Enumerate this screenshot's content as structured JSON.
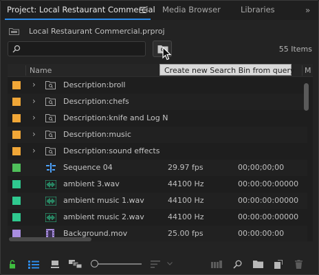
{
  "tabs": [
    {
      "label": "Project: Local Restaurant Commercial",
      "active": true
    },
    {
      "label": "Media Browser",
      "active": false
    },
    {
      "label": "Libraries",
      "active": false
    }
  ],
  "project": {
    "file_name": "Local Restaurant Commercial.prproj"
  },
  "search": {
    "value": "",
    "placeholder": ""
  },
  "items_count": "55 Items",
  "tooltip": "Create new Search Bin from query",
  "columns": {
    "name": "Name",
    "media_start_abbrev": "M"
  },
  "rows": [
    {
      "type": "search-bin",
      "color": "#f0a637",
      "name": "Description:broll",
      "rate": "",
      "start": ""
    },
    {
      "type": "search-bin",
      "color": "#f0a637",
      "name": "Description:chefs",
      "rate": "",
      "start": ""
    },
    {
      "type": "search-bin",
      "color": "#f0a637",
      "name": "Description:knife and Log N",
      "rate": "",
      "start": ""
    },
    {
      "type": "search-bin",
      "color": "#f0a637",
      "name": "Description:music",
      "rate": "",
      "start": ""
    },
    {
      "type": "search-bin",
      "color": "#f0a637",
      "name": "Description:sound effects",
      "rate": "",
      "start": ""
    },
    {
      "type": "sequence",
      "color": "#4fbf5a",
      "name": "Sequence 04",
      "rate": "29.97 fps",
      "start": "00;00;00;00"
    },
    {
      "type": "audio",
      "color": "#2fc98f",
      "name": "ambient 3.wav",
      "rate": "44100 Hz",
      "start": "00:00:00:00000"
    },
    {
      "type": "audio",
      "color": "#2fc98f",
      "name": "ambient music 1.wav",
      "rate": "44100 Hz",
      "start": "00:00:00:00000"
    },
    {
      "type": "audio",
      "color": "#2fc98f",
      "name": "ambient music 2.wav",
      "rate": "44100 Hz",
      "start": "00:00:00:00000"
    },
    {
      "type": "video",
      "color": "#a98ee0",
      "name": "Background.mov",
      "rate": "25.00 fps",
      "start": "00:00:00:00"
    }
  ],
  "toolbar_icons": [
    "lock-icon",
    "list-view-icon",
    "icon-view-icon",
    "freeform-view-icon",
    "zoom-slider",
    "sort-icon",
    "automate-to-sequence-icon",
    "find-icon",
    "new-bin-icon",
    "new-item-icon",
    "clear-icon"
  ],
  "colors": {
    "accent": "#2d8ceb",
    "lock": "#3fbf3f",
    "list_view": "#2d8ceb"
  }
}
